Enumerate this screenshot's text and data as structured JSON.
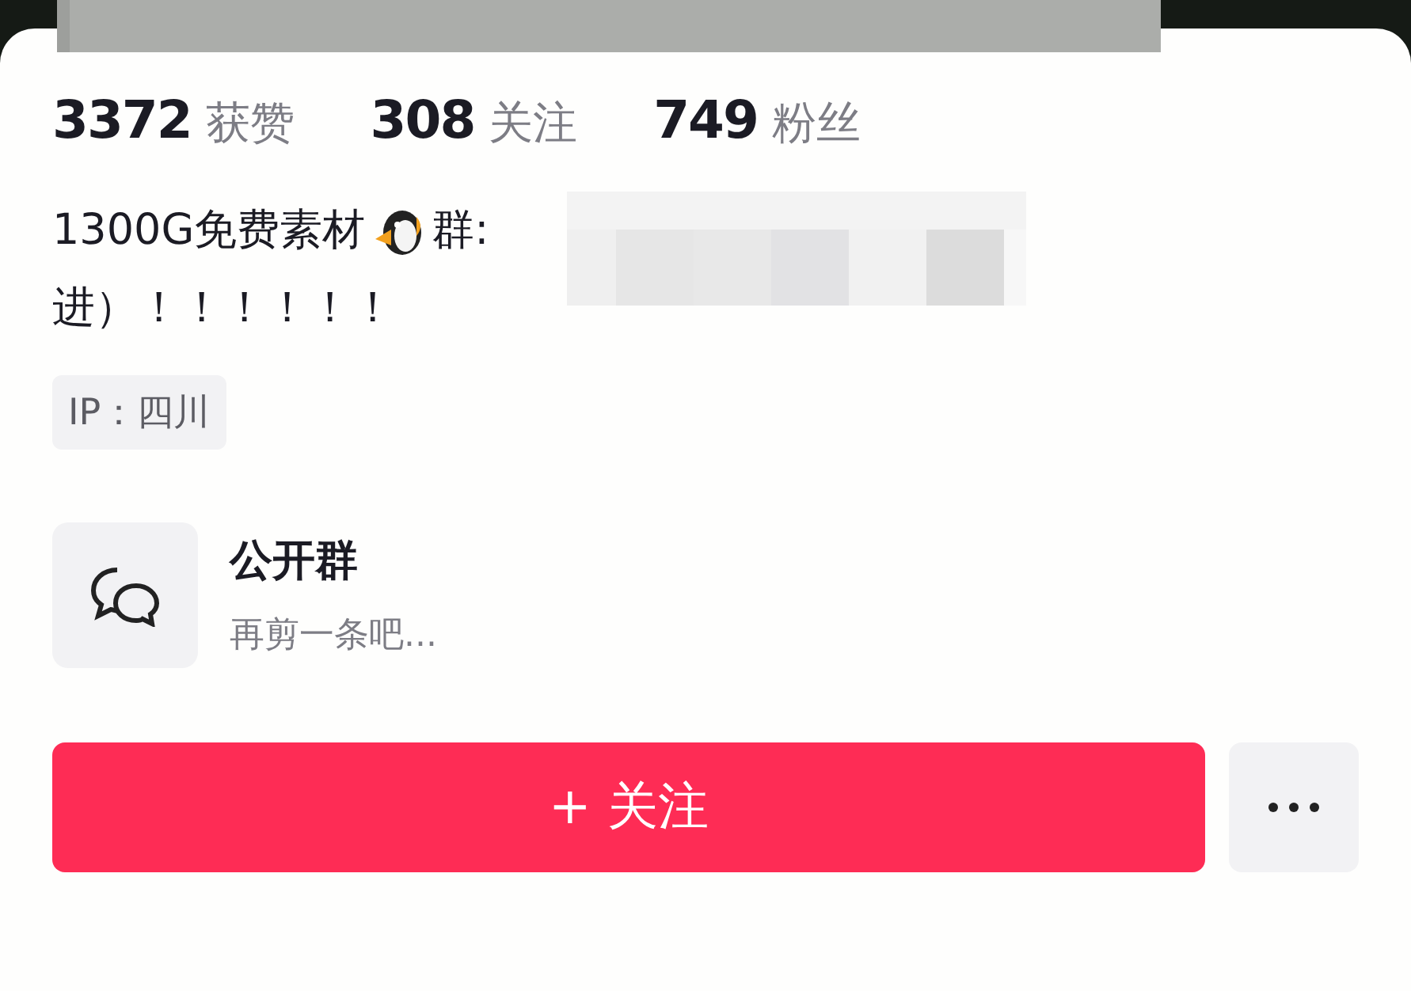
{
  "stats": [
    "**3372** 获赞",
    "**308** 关注",
    "**749** 粉丝"
  ],
  "bio": {
    "text_before_emoji": "1300G免费素材",
    "text_after_emoji": "群:",
    "second_line": "进）！！！！！！"
  },
  "ip_tag": "IP：四川",
  "group": {
    "title": "公开群",
    "subtitle": "再剪一条吧..."
  },
  "follow_button": "+ 关注"
}
